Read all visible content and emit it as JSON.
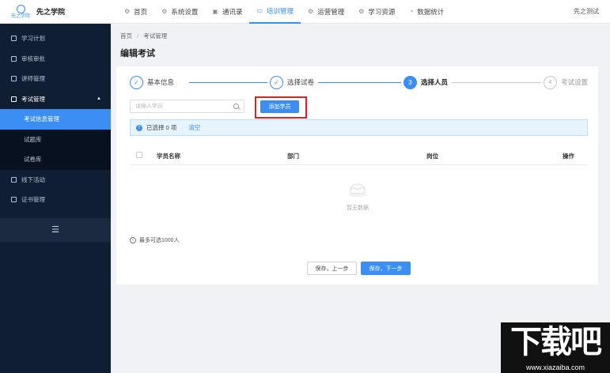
{
  "app": {
    "logo_text": "先之学院",
    "logo_sub": "先之学院",
    "user_name": "先之测试"
  },
  "topnav": [
    {
      "label": "首页",
      "icon": "gear-icon",
      "active": false
    },
    {
      "label": "系统设置",
      "icon": "gear-icon",
      "active": false
    },
    {
      "label": "通讯录",
      "icon": "contacts-icon",
      "active": false
    },
    {
      "label": "培训管理",
      "icon": "training-icon",
      "active": true
    },
    {
      "label": "运营管理",
      "icon": "gear-icon",
      "active": false
    },
    {
      "label": "学习资源",
      "icon": "gear-icon",
      "active": false
    },
    {
      "label": "数据统计",
      "icon": "chart-icon",
      "active": false
    }
  ],
  "sidebar": {
    "items": [
      {
        "label": "学习计划"
      },
      {
        "label": "审核审批"
      },
      {
        "label": "讲师管理"
      },
      {
        "label": "考试管理",
        "open": true
      }
    ],
    "submenu": [
      {
        "label": "考试信息管理",
        "active": true
      },
      {
        "label": "试题库"
      },
      {
        "label": "试卷库"
      }
    ],
    "items_after": [
      {
        "label": "线下活动"
      },
      {
        "label": "证书管理"
      }
    ],
    "collapse_glyph": "☰"
  },
  "breadcrumb": {
    "home": "首页",
    "separator": "/",
    "current": "考试管理"
  },
  "page": {
    "title": "编辑考试"
  },
  "steps": [
    {
      "label": "基本信息",
      "marker": "✓",
      "state": "done"
    },
    {
      "label": "选择试卷",
      "marker": "✓",
      "state": "done"
    },
    {
      "label": "选择人员",
      "marker": "3",
      "state": "current"
    },
    {
      "label": "考试设置",
      "marker": "4",
      "state": "todo"
    }
  ],
  "search": {
    "placeholder": "请输入学员",
    "value": ""
  },
  "add_button": {
    "label": "添加学员"
  },
  "selection_info": {
    "text": "已选择 0 项",
    "clear_label": "清空"
  },
  "table": {
    "columns": [
      "学员名称",
      "部门",
      "岗位",
      "操作"
    ],
    "rows": []
  },
  "empty": {
    "text": "暂无数据"
  },
  "limit_note": {
    "text": "最多可选1000人"
  },
  "footer_buttons": {
    "prev_label": "保存，上一步",
    "next_label": "保存，下一步"
  },
  "colors": {
    "accent": "#3b8ef3",
    "sidebar_bg": "#0f1e33",
    "highlight_border": "#e02020"
  },
  "watermark": {
    "big": "下载吧",
    "url": "www.xiazaiba.com"
  }
}
